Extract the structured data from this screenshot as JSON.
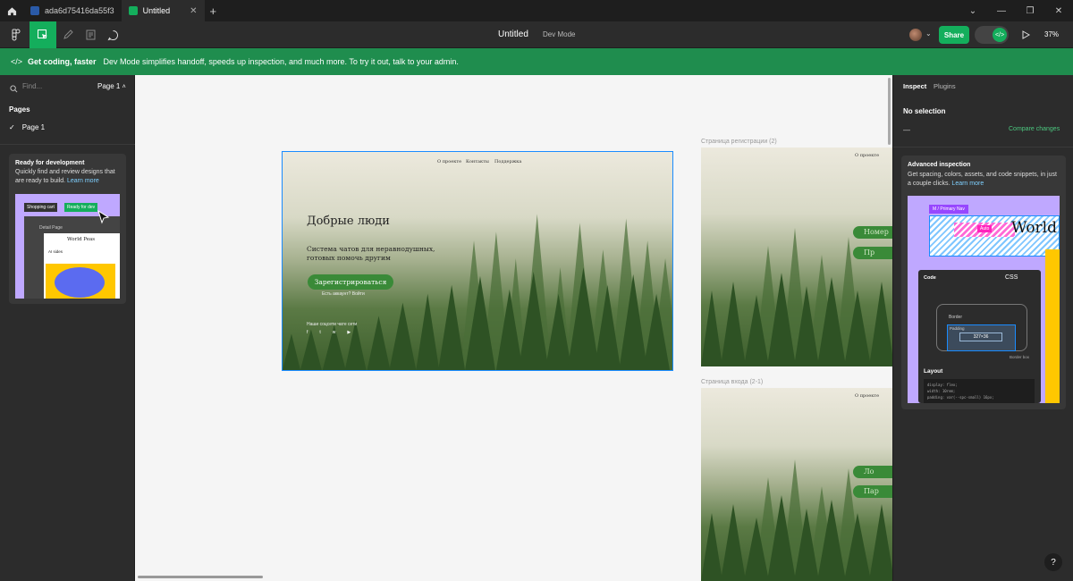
{
  "tabs": [
    {
      "label": "ada6d75416da55f3",
      "active": false
    },
    {
      "label": "Untitled",
      "active": true
    }
  ],
  "toolbar": {
    "file_name": "Untitled",
    "mode": "Dev Mode",
    "share_label": "Share",
    "zoom": "37%"
  },
  "banner": {
    "title": "Get coding, faster",
    "text": "Dev Mode simplifies handoff, speeds up inspection, and much more. To try it out, talk to your admin."
  },
  "left": {
    "search_placeholder": "Find...",
    "page_selector": "Page 1",
    "pages_heading": "Pages",
    "pages": [
      "Page 1"
    ],
    "ready": {
      "title": "Ready for development",
      "desc": "Quickly find and review designs that are ready to build.",
      "link": "Learn more",
      "ill": {
        "chip1": "Shopping cart",
        "chip2": "Ready for dev",
        "detail": "Detail Page",
        "brand": "World Peas",
        "chip3": "AI sides"
      }
    }
  },
  "canvas": {
    "frame1": {
      "nav": [
        "О проекте",
        "Контакты",
        "Поддержка"
      ],
      "title": "Добрые люди",
      "subtitle": "Система чатов для неравнодушных, готовых помочь другим",
      "button": "Зарегистрироваться",
      "login": "Есть аккаунт? Войти",
      "social": "Наши соцсети чате сети"
    },
    "frame2": {
      "label": "Страница регистрации (2)",
      "nav": "О проекте",
      "pill1": "Номер",
      "pill2": "Пр"
    },
    "frame3": {
      "label": "Страница входа (2-1)",
      "nav": "О проекте",
      "pill1": "Ло",
      "pill2": "Пар"
    }
  },
  "right": {
    "tabs": [
      "Inspect",
      "Plugins"
    ],
    "no_selection": "No selection",
    "dash": "—",
    "compare": "Compare changes",
    "advanced": {
      "title": "Advanced inspection",
      "desc": "Get spacing, colors, assets, and code snippets, in just a couple clicks.",
      "link": "Learn more",
      "ill": {
        "nav_chip": "M / Primary Nav",
        "auto": "Auto",
        "word": "World",
        "code": "Code",
        "css": "CSS",
        "border": "Border",
        "padding": "Padding",
        "size": "327×36",
        "layout": "Layout",
        "border_box": "Border box",
        "code_lines": [
          "display: flex;",
          "width: 10rem;",
          "padding: var(--spc-small) 16px;"
        ]
      }
    }
  },
  "help": "?"
}
